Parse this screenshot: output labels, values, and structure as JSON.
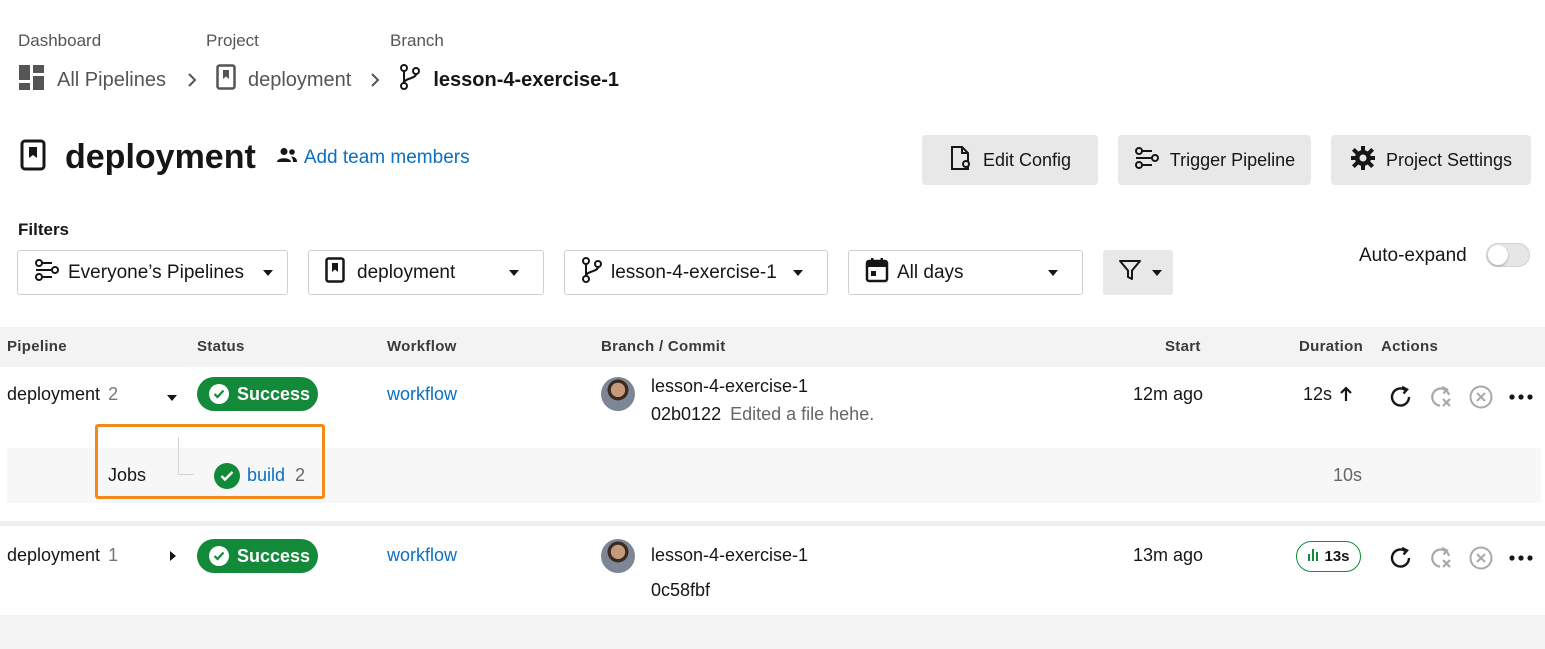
{
  "breadcrumb": {
    "dashboard_label": "Dashboard",
    "project_label": "Project",
    "branch_label": "Branch",
    "all_pipelines": "All Pipelines",
    "project": "deployment",
    "branch": "lesson-4-exercise-1"
  },
  "header": {
    "title": "deployment",
    "add_team": "Add team members",
    "edit_config": "Edit Config",
    "trigger_pipeline": "Trigger Pipeline",
    "project_settings": "Project Settings"
  },
  "filters": {
    "label": "Filters",
    "pipelines": "Everyone’s Pipelines",
    "project": "deployment",
    "branch": "lesson-4-exercise-1",
    "days": "All days",
    "auto_expand": "Auto-expand",
    "auto_expand_on": false
  },
  "table": {
    "columns": {
      "pipeline": "Pipeline",
      "status": "Status",
      "workflow": "Workflow",
      "branch_commit": "Branch / Commit",
      "start": "Start",
      "duration": "Duration",
      "actions": "Actions"
    },
    "rows": [
      {
        "name": "deployment",
        "number": "2",
        "status": "Success",
        "workflow": "workflow",
        "branch": "lesson-4-exercise-1",
        "commit": "02b0122",
        "message": "Edited a file hehe.",
        "start": "12m ago",
        "duration": "12s",
        "jobs_label": "Jobs",
        "job_name": "build",
        "job_number": "2",
        "job_duration": "10s"
      },
      {
        "name": "deployment",
        "number": "1",
        "status": "Success",
        "workflow": "workflow",
        "branch": "lesson-4-exercise-1",
        "commit": "0c58fbf",
        "start": "13m ago",
        "duration": "13s"
      }
    ]
  },
  "colors": {
    "success": "#128a3a",
    "link": "#0b6fc2",
    "highlight": "#f28a1b"
  }
}
